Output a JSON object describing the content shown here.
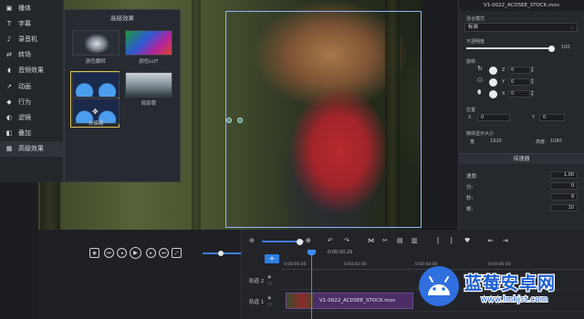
{
  "left_menu": {
    "items": [
      {
        "label": "播体",
        "icon": "media-icon"
      },
      {
        "label": "字幕",
        "icon": "text-icon"
      },
      {
        "label": "录音机",
        "icon": "microphone-icon"
      },
      {
        "label": "转场",
        "icon": "transition-icon"
      },
      {
        "label": "音频效果",
        "icon": "audio-effect-icon"
      },
      {
        "label": "动画",
        "icon": "animation-icon"
      },
      {
        "label": "行为",
        "icon": "behavior-icon"
      },
      {
        "label": "滤镜",
        "icon": "filter-icon"
      },
      {
        "label": "叠加",
        "icon": "overlay-icon"
      },
      {
        "label": "高级效果",
        "icon": "advanced-effects-icon",
        "active": true
      }
    ]
  },
  "effects_panel": {
    "title": "高级效果",
    "effects": [
      {
        "label": "颜色翻转"
      },
      {
        "label": "颜色LUT"
      },
      {
        "label": "去模糊"
      },
      {
        "label": "局部雾"
      }
    ]
  },
  "playback": {
    "buttons": [
      "screenshot",
      "previous",
      "back",
      "play",
      "next",
      "forward",
      "fullscreen"
    ],
    "progress": 0.45
  },
  "timeline": {
    "current_time": "0:00:00.29",
    "ruler": [
      "0:00:00.00",
      "0:00:02:00",
      "0:00:04:00",
      "0:00:06:00"
    ],
    "tracks": [
      {
        "label": "轨道 2"
      },
      {
        "label": "轨道 1"
      }
    ],
    "clip_name": "V1-0022_ACDSEE_STOCK.mov"
  },
  "properties": {
    "file_title": "V1-0022_ACDSEE_STOCK.mov",
    "blend_label": "混合模式",
    "blend_value": "标准",
    "opacity_label": "不透明度",
    "opacity_value": "100",
    "rotation_label": "旋转",
    "rotation": [
      {
        "axis": "Z",
        "value": "0"
      },
      {
        "axis": "Y",
        "value": "0"
      },
      {
        "axis": "X",
        "value": "0"
      }
    ],
    "position_label": "位置",
    "position_x_label": "X",
    "position_x": "0",
    "position_y_label": "Y",
    "position_y": "0",
    "size_label": "媒体显示大小",
    "width_label": "宽",
    "width_value": "1920",
    "height_label": "高度:",
    "height_value": "1080"
  },
  "speed_panel": {
    "title": "倍速器",
    "rows": [
      {
        "label": "速度:",
        "value": "1.00"
      },
      {
        "label": "分:",
        "value": "0"
      },
      {
        "label": "秒:",
        "value": "9"
      },
      {
        "label": "帧:",
        "value": "10"
      }
    ]
  },
  "watermark": {
    "title": "蓝莓安卓网",
    "url": "www.lmkjst.com"
  },
  "colors": {
    "accent": "#2f7de1",
    "clip": "#4c2e66",
    "selection": "#d9c35a"
  }
}
